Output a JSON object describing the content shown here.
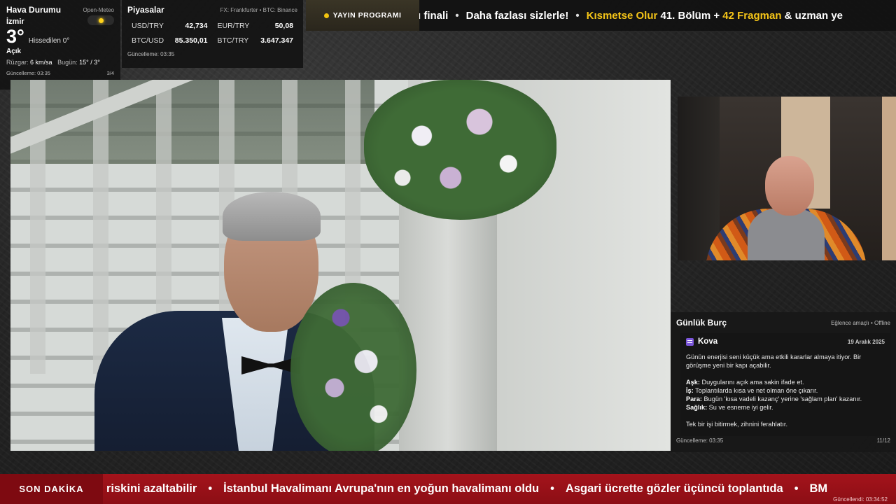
{
  "weather": {
    "title": "Hava Durumu",
    "source": "Open-Meteo",
    "city": "İzmir",
    "temperature": "3°",
    "feels_like": "Hissedilen 0°",
    "condition": "Açık",
    "wind_label": "Rüzgar:",
    "wind_value": "6 km/sa",
    "today_label": "Bugün:",
    "today_value": "15° / 3°",
    "updated": "Güncelleme: 03:35",
    "page": "3/4",
    "icon": "sun-icon",
    "accent": "#ffd21a"
  },
  "markets": {
    "title": "Piyasalar",
    "source": "FX: Frankfurter • BTC: Binance",
    "rates": [
      {
        "pair": "USD/TRY",
        "value": "42,734"
      },
      {
        "pair": "EUR/TRY",
        "value": "50,08"
      },
      {
        "pair": "BTC/USD",
        "value": "85.350,01"
      },
      {
        "pair": "BTC/TRY",
        "value": "3.647.347"
      }
    ],
    "updated": "Güncelleme: 03:35"
  },
  "top_ticker": {
    "schedule_label": "YAYIN PROGRAMI",
    "items": [
      {
        "plain": "ı finali",
        "highlight": ""
      },
      {
        "plain": "Daha fazlası sizlerle!",
        "highlight": ""
      }
    ],
    "last": {
      "hl1": "Kısmetse Olur",
      "mid": " 41. Bölüm + ",
      "hl2": "42 Fragman",
      "tail": " & uzman ye"
    },
    "accent": "#f5c518"
  },
  "horoscope": {
    "title": "Günlük Burç",
    "meta": "Eğlence amaçlı • Offline",
    "sign": "Kova",
    "date": "19 Aralık 2025",
    "intro": "Günün enerjisi seni küçük ama etkili kararlar almaya itiyor. Bir görüşme yeni bir kapı açabilir.",
    "love_label": "Aşk:",
    "love": " Duygularını açık ama sakin ifade et.",
    "work_label": "İş:",
    "work": " Toplantılarda kısa ve net olman öne çıkarır.",
    "money_label": "Para:",
    "money": " Bugün 'kısa vadeli kazanç' yerine 'sağlam plan' kazanır.",
    "health_label": "Sağlık:",
    "health": " Su ve esneme iyi gelir.",
    "tip": "Tek bir işi bitirmek, zihnini ferahlatır.",
    "updated": "Güncelleme: 03:35",
    "page": "11/12",
    "sign_color": "#7b56d9"
  },
  "breaking": {
    "label": "SON DAKİKA",
    "items": [
      "riskini azaltabilir",
      "İstanbul Havalimanı Avrupa'nın en yoğun havalimanı oldu",
      "Asgari ücrette gözler üçüncü toplantıda",
      "BM"
    ],
    "updated": "Güncellendi: 03:34:52",
    "color": "#a4131b"
  }
}
